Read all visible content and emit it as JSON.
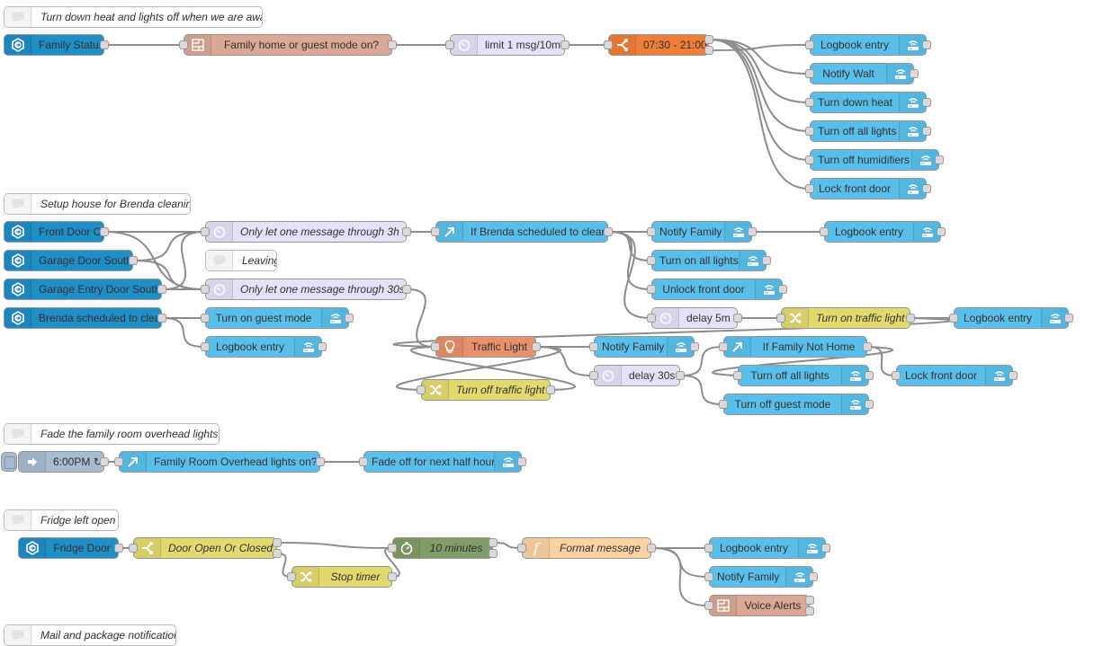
{
  "app": "Node-RED flow editor",
  "palette": {
    "events-state": "#1f8dc6",
    "current-state": "#d9a794",
    "rate-limit": "#e6e0f8",
    "delay": "#e6e0f8",
    "time-range": "#ef7e38",
    "call-service": "#59bfea",
    "switch": "#59bfea",
    "change": "#e2d96e",
    "switch-yellow": "#e2d96e",
    "traffic-light": "#e8906b",
    "inject": "#a6bbcf",
    "function": "#fdd0a2",
    "timer": "#819c67",
    "voice-alerts": "#d9a794",
    "comment": "#ffffff",
    "wire": "#8c8c8c",
    "port": "#d9d9d9"
  },
  "nodes": [
    {
      "id": "c1",
      "label": "Turn down heat and lights off when we are away",
      "kind": "comment",
      "icon": "comment-icon"
    },
    {
      "id": "fs",
      "label": "Family Status",
      "kind": "events-state",
      "icon": "event-entry-icon",
      "inputs": 0,
      "outputs": 1
    },
    {
      "id": "fh",
      "label": "Family home or guest mode on?",
      "kind": "current-state",
      "icon": "api-state-icon",
      "inputs": 1,
      "outputs": 1
    },
    {
      "id": "lim",
      "label": "limit 1 msg/10m",
      "kind": "rate-limit",
      "icon": "timer-icon",
      "inputs": 1,
      "outputs": 1
    },
    {
      "id": "tr",
      "label": "07:30 - 21:00",
      "kind": "time-range",
      "icon": "split-icon",
      "inputs": 1,
      "outputs": 2
    },
    {
      "id": "a1",
      "label": "Logbook entry",
      "kind": "call-service",
      "icon": "router-icon",
      "inputs": 1,
      "outputs": 1
    },
    {
      "id": "a2",
      "label": "Notify Walt",
      "kind": "call-service",
      "icon": "router-icon",
      "inputs": 1,
      "outputs": 1
    },
    {
      "id": "a3",
      "label": "Turn down heat",
      "kind": "call-service",
      "icon": "router-icon",
      "inputs": 1,
      "outputs": 1
    },
    {
      "id": "a4",
      "label": "Turn off all lights",
      "kind": "call-service",
      "icon": "router-icon",
      "inputs": 1,
      "outputs": 1
    },
    {
      "id": "a5",
      "label": "Turn off humidifiers",
      "kind": "call-service",
      "icon": "router-icon",
      "inputs": 1,
      "outputs": 1
    },
    {
      "id": "a6",
      "label": "Lock front door",
      "kind": "call-service",
      "icon": "router-icon",
      "inputs": 1,
      "outputs": 1
    },
    {
      "id": "c2",
      "label": "Setup house for Brenda cleaning",
      "kind": "comment",
      "icon": "comment-icon"
    },
    {
      "id": "fdo",
      "label": "Front Door Open",
      "kind": "events-state",
      "icon": "event-entry-icon",
      "inputs": 0,
      "outputs": 1
    },
    {
      "id": "gds",
      "label": "Garage Door South",
      "kind": "events-state",
      "icon": "event-entry-icon",
      "inputs": 0,
      "outputs": 1
    },
    {
      "id": "geds",
      "label": "Garage Entry Door South",
      "kind": "events-state",
      "icon": "event-entry-icon",
      "inputs": 0,
      "outputs": 1
    },
    {
      "id": "bsc",
      "label": "Brenda scheduled to clean",
      "kind": "events-state",
      "icon": "event-entry-icon",
      "inputs": 0,
      "outputs": 1
    },
    {
      "id": "r3h",
      "label": "Only let one message through 3h",
      "kind": "rate-limit",
      "icon": "timer-icon",
      "inputs": 1,
      "outputs": 1
    },
    {
      "id": "cl",
      "label": "Leaving",
      "kind": "comment",
      "icon": "comment-icon"
    },
    {
      "id": "r30",
      "label": "Only let one message through 30s",
      "kind": "rate-limit",
      "icon": "timer-icon",
      "inputs": 1,
      "outputs": 1
    },
    {
      "id": "tgm",
      "label": "Turn on guest mode",
      "kind": "call-service",
      "icon": "router-icon",
      "inputs": 1,
      "outputs": 1
    },
    {
      "id": "lb2",
      "label": "Logbook entry",
      "kind": "call-service",
      "icon": "router-icon",
      "inputs": 1,
      "outputs": 1
    },
    {
      "id": "ibs",
      "label": "If Brenda scheduled to clean",
      "kind": "switch",
      "icon": "arrow-up-right-icon",
      "inputs": 1,
      "outputs": 1
    },
    {
      "id": "nf1",
      "label": "Notify Family",
      "kind": "call-service",
      "icon": "router-icon",
      "inputs": 1,
      "outputs": 1
    },
    {
      "id": "lb3",
      "label": "Logbook entry",
      "kind": "call-service",
      "icon": "router-icon",
      "inputs": 1,
      "outputs": 1
    },
    {
      "id": "toal",
      "label": "Turn on all lights",
      "kind": "call-service",
      "icon": "router-icon",
      "inputs": 1,
      "outputs": 1
    },
    {
      "id": "ufd",
      "label": "Unlock front door",
      "kind": "call-service",
      "icon": "router-icon",
      "inputs": 1,
      "outputs": 1
    },
    {
      "id": "d5",
      "label": "delay 5m",
      "kind": "delay",
      "icon": "timer-icon",
      "inputs": 1,
      "outputs": 1
    },
    {
      "id": "totl",
      "label": "Turn on traffic light",
      "kind": "change",
      "icon": "shuffle-icon",
      "inputs": 1,
      "outputs": 1
    },
    {
      "id": "lb4",
      "label": "Logbook entry",
      "kind": "call-service",
      "icon": "router-icon",
      "inputs": 1,
      "outputs": 1
    },
    {
      "id": "tl",
      "label": "Traffic Light",
      "kind": "traffic-light",
      "icon": "light-bulb-icon",
      "inputs": 1,
      "outputs": 1
    },
    {
      "id": "nf2",
      "label": "Notify Family",
      "kind": "call-service",
      "icon": "router-icon",
      "inputs": 1,
      "outputs": 1
    },
    {
      "id": "d30",
      "label": "delay 30s",
      "kind": "delay",
      "icon": "timer-icon",
      "inputs": 1,
      "outputs": 1
    },
    {
      "id": "tftl",
      "label": "Turn off traffic light",
      "kind": "change",
      "icon": "shuffle-icon",
      "inputs": 1,
      "outputs": 1
    },
    {
      "id": "ifnh",
      "label": "If Family Not Home",
      "kind": "switch",
      "icon": "arrow-up-right-icon",
      "inputs": 1,
      "outputs": 1
    },
    {
      "id": "tfal",
      "label": "Turn off all lights",
      "kind": "call-service",
      "icon": "router-icon",
      "inputs": 1,
      "outputs": 1
    },
    {
      "id": "tfgm",
      "label": "Turn off guest mode",
      "kind": "call-service",
      "icon": "router-icon",
      "inputs": 1,
      "outputs": 1
    },
    {
      "id": "lfd2",
      "label": "Lock front door",
      "kind": "call-service",
      "icon": "router-icon",
      "inputs": 1,
      "outputs": 1
    },
    {
      "id": "c3",
      "label": "Fade the family room overhead lights",
      "kind": "comment",
      "icon": "comment-icon"
    },
    {
      "id": "inj",
      "label": "6:00PM ↻",
      "kind": "inject",
      "icon": "inject-arrow-icon",
      "inputs": 0,
      "outputs": 1
    },
    {
      "id": "fro",
      "label": "Family Room Overhead lights on?",
      "kind": "switch",
      "icon": "arrow-up-right-icon",
      "inputs": 1,
      "outputs": 1
    },
    {
      "id": "fade",
      "label": "Fade off for next half hour",
      "kind": "call-service",
      "icon": "router-icon",
      "inputs": 1,
      "outputs": 1
    },
    {
      "id": "c4",
      "label": "Fridge left open",
      "kind": "comment",
      "icon": "comment-icon"
    },
    {
      "id": "frd",
      "label": "Fridge Door",
      "kind": "events-state",
      "icon": "event-entry-icon",
      "inputs": 0,
      "outputs": 1
    },
    {
      "id": "doc",
      "label": "Door Open Or Closed",
      "kind": "switch-yellow",
      "icon": "split-icon",
      "inputs": 1,
      "outputs": 2
    },
    {
      "id": "st",
      "label": "Stop timer",
      "kind": "change",
      "icon": "shuffle-icon",
      "inputs": 1,
      "outputs": 1
    },
    {
      "id": "t10",
      "label": "10 minutes",
      "kind": "timer",
      "icon": "stopwatch-icon",
      "inputs": 1,
      "outputs": 2
    },
    {
      "id": "fm",
      "label": "Format message",
      "kind": "function",
      "icon": "function-icon",
      "inputs": 1,
      "outputs": 1
    },
    {
      "id": "lb5",
      "label": "Logbook entry",
      "kind": "call-service",
      "icon": "router-icon",
      "inputs": 1,
      "outputs": 1
    },
    {
      "id": "nf3",
      "label": "Notify Family",
      "kind": "call-service",
      "icon": "router-icon",
      "inputs": 1,
      "outputs": 1
    },
    {
      "id": "va",
      "label": "Voice Alerts",
      "kind": "voice-alerts",
      "icon": "api-state-icon",
      "inputs": 1,
      "outputs": 2
    },
    {
      "id": "c5",
      "label": "Mail and package notifications",
      "kind": "comment",
      "icon": "comment-icon"
    }
  ],
  "wires": [
    [
      "fs",
      0,
      "fh"
    ],
    [
      "fh",
      0,
      "lim"
    ],
    [
      "lim",
      0,
      "tr"
    ],
    [
      "tr",
      1,
      "a1"
    ],
    [
      "tr",
      0,
      "a2"
    ],
    [
      "tr",
      0,
      "a3"
    ],
    [
      "tr",
      0,
      "a4"
    ],
    [
      "tr",
      0,
      "a5"
    ],
    [
      "tr",
      0,
      "a6"
    ],
    [
      "fdo",
      0,
      "r3h"
    ],
    [
      "fdo",
      0,
      "r30"
    ],
    [
      "gds",
      0,
      "r3h"
    ],
    [
      "gds",
      0,
      "r30"
    ],
    [
      "geds",
      0,
      "r3h"
    ],
    [
      "geds",
      0,
      "r30"
    ],
    [
      "bsc",
      0,
      "tgm"
    ],
    [
      "bsc",
      0,
      "lb2"
    ],
    [
      "r3h",
      0,
      "ibs"
    ],
    [
      "ibs",
      0,
      "nf1"
    ],
    [
      "ibs",
      0,
      "toal"
    ],
    [
      "ibs",
      0,
      "ufd"
    ],
    [
      "ibs",
      0,
      "d5"
    ],
    [
      "nf1",
      0,
      "lb3"
    ],
    [
      "d5",
      0,
      "totl"
    ],
    [
      "totl",
      0,
      "lb4"
    ],
    [
      "totl",
      0,
      "tl"
    ],
    [
      "r30",
      0,
      "tl"
    ],
    [
      "tl",
      0,
      "nf2"
    ],
    [
      "tl",
      0,
      "d30"
    ],
    [
      "tl",
      0,
      "tftl"
    ],
    [
      "tftl",
      0,
      "tl"
    ],
    [
      "d30",
      0,
      "ifnh"
    ],
    [
      "d30",
      0,
      "tfgm"
    ],
    [
      "ifnh",
      0,
      "tfal"
    ],
    [
      "ifnh",
      0,
      "lfd2"
    ],
    [
      "inj",
      0,
      "fro"
    ],
    [
      "fro",
      0,
      "fade"
    ],
    [
      "frd",
      0,
      "doc"
    ],
    [
      "doc",
      0,
      "t10"
    ],
    [
      "doc",
      1,
      "st"
    ],
    [
      "st",
      0,
      "t10"
    ],
    [
      "t10",
      0,
      "fm"
    ],
    [
      "fm",
      0,
      "lb5"
    ],
    [
      "fm",
      0,
      "nf3"
    ],
    [
      "fm",
      0,
      "va"
    ]
  ],
  "inject_button_label": "inject"
}
